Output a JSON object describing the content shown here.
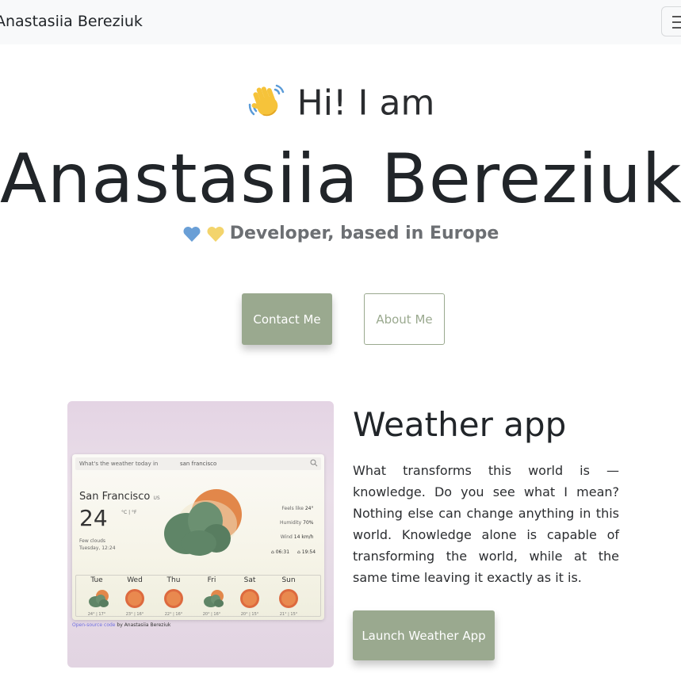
{
  "navbar": {
    "brand": "Anastasiia Bereziuk",
    "menu_icon": "hamburger-icon"
  },
  "hero": {
    "greeting": "Hi! I am",
    "greeting_icon": "waving-hand-icon",
    "name": "Anastasiia Bereziuk",
    "tagline": "Developer, based in Europe",
    "tagline_icons": [
      "blue-heart-icon",
      "yellow-heart-icon"
    ],
    "contact_label": "Contact Me",
    "about_label": "About Me"
  },
  "project": {
    "title": "Weather app",
    "description": "What transforms this world is — knowledge. Do you see what I mean? Nothing else can change anything in this world. Knowledge alone is capable of transforming the world, while at the same time leaving it exactly as it is.",
    "button_label": "Launch Weather App",
    "preview": {
      "search_question": "What's the weather today in",
      "search_value": "san francisco",
      "city": "San Francisco",
      "country": "US",
      "temperature": "24",
      "units": "°C | °F",
      "condition": "Few clouds",
      "datetime": "Tuesday, 12:24",
      "feels_like_label": "Feels like",
      "feels_like": "24°",
      "humidity_label": "Humidity",
      "humidity": "70%",
      "wind_label": "Wind",
      "wind": "14 km/h",
      "sunrise": "06:31",
      "sunset": "19:54",
      "forecast": [
        {
          "day": "Tue",
          "temps": "24° | 17°",
          "icon": "partly-cloudy-icon"
        },
        {
          "day": "Wed",
          "temps": "23° | 16°",
          "icon": "sun-icon"
        },
        {
          "day": "Thu",
          "temps": "22° | 16°",
          "icon": "sun-icon"
        },
        {
          "day": "Fri",
          "temps": "20° | 16°",
          "icon": "partly-cloudy-icon"
        },
        {
          "day": "Sat",
          "temps": "20° | 15°",
          "icon": "sun-icon"
        },
        {
          "day": "Sun",
          "temps": "21° | 15°",
          "icon": "sun-icon"
        }
      ],
      "credit_link": "Open-source code",
      "credit_text": "by Anastasiia Bereziuk"
    }
  },
  "colors": {
    "accent": "#9aa98f",
    "navbar_bg": "#f8f9fa",
    "text": "#212529",
    "muted": "#6c6f73"
  }
}
